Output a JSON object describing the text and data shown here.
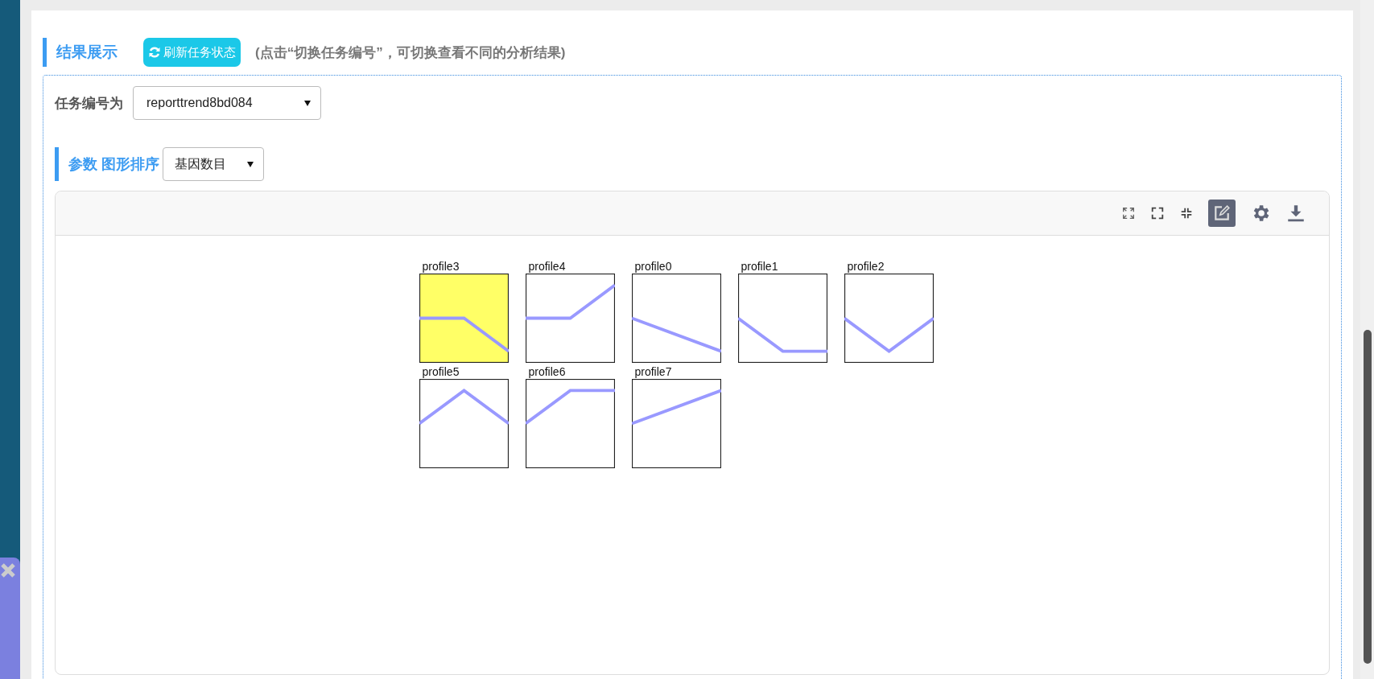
{
  "section": {
    "title": "结果展示",
    "refresh_button": "刷新任务状态",
    "hint": "(点击“切换任务编号”，可切换查看不同的分析结果)"
  },
  "task": {
    "label": "任务编号为",
    "value": "reporttrend8bd084"
  },
  "sort": {
    "title": "参数 图形排序",
    "value": "基因数目"
  },
  "profiles": [
    {
      "label": "profile3",
      "kind": "flatfall",
      "highlighted": true
    },
    {
      "label": "profile4",
      "kind": "flatrise",
      "highlighted": false
    },
    {
      "label": "profile0",
      "kind": "fall",
      "highlighted": false
    },
    {
      "label": "profile1",
      "kind": "fallflat",
      "highlighted": false
    },
    {
      "label": "profile2",
      "kind": "valley",
      "highlighted": false
    },
    {
      "label": "profile5",
      "kind": "peak",
      "highlighted": false
    },
    {
      "label": "profile6",
      "kind": "riseflat",
      "highlighted": false
    },
    {
      "label": "profile7",
      "kind": "rise",
      "highlighted": false
    }
  ]
}
